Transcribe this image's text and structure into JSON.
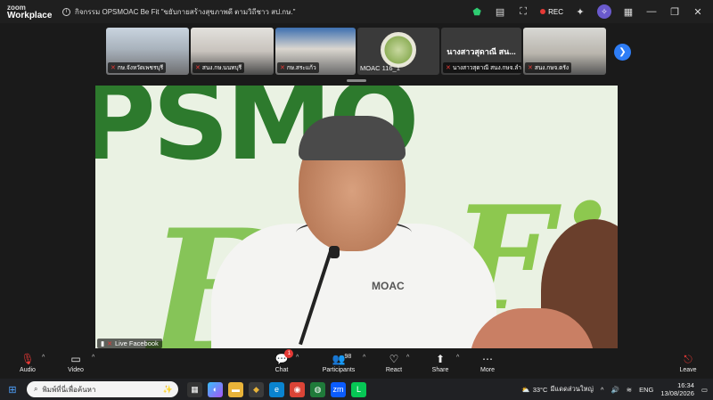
{
  "titlebar": {
    "brand_line1": "zoom",
    "brand_line2": "Workplace",
    "meeting_title": "กิจกรรม OPSMOAC Be Fit \"ขยับกายสร้างสุขภาพดี ตามวิถีชาว สป.กษ.\"",
    "rec_label": "REC"
  },
  "thumbnails": [
    {
      "name": "กษ.จังหวัดเพชรบุรี",
      "muted": true
    },
    {
      "name": "สนง.กษ.นนทบุรี",
      "muted": true
    },
    {
      "name": "กษ.สระแก้ว",
      "muted": true
    },
    {
      "name": "MOAC 116_1",
      "muted": false
    },
    {
      "name": "นางสาวสุดาณี สน...",
      "label": "นางสาวสุดาณี สนง.กษจ.ลำปาง",
      "muted": true
    },
    {
      "name": "สนง.กษจ.ตรัง",
      "muted": true
    }
  ],
  "video": {
    "live_label": "Live Facebook",
    "shirt_logo": "MOAC",
    "bg_text1": "PSMO",
    "bg_text2": "Be",
    "bg_text3": "Fit"
  },
  "controls": {
    "audio": "Audio",
    "video": "Video",
    "chat": "Chat",
    "chat_badge": "1",
    "participants": "Participants",
    "participants_count": "98",
    "react": "React",
    "share": "Share",
    "more": "More",
    "leave": "Leave"
  },
  "taskbar": {
    "search_placeholder": "พิมพ์ที่นี่เพื่อค้นหา",
    "weather": "33°C",
    "weather_desc": "มีแดดส่วนใหญ่",
    "lang": "ENG",
    "time": "16:34",
    "date": "13/08/2026"
  },
  "colors": {
    "accent_blue": "#2e7df6",
    "rec_red": "#e53935",
    "brand_green": "#2d7a2d"
  }
}
